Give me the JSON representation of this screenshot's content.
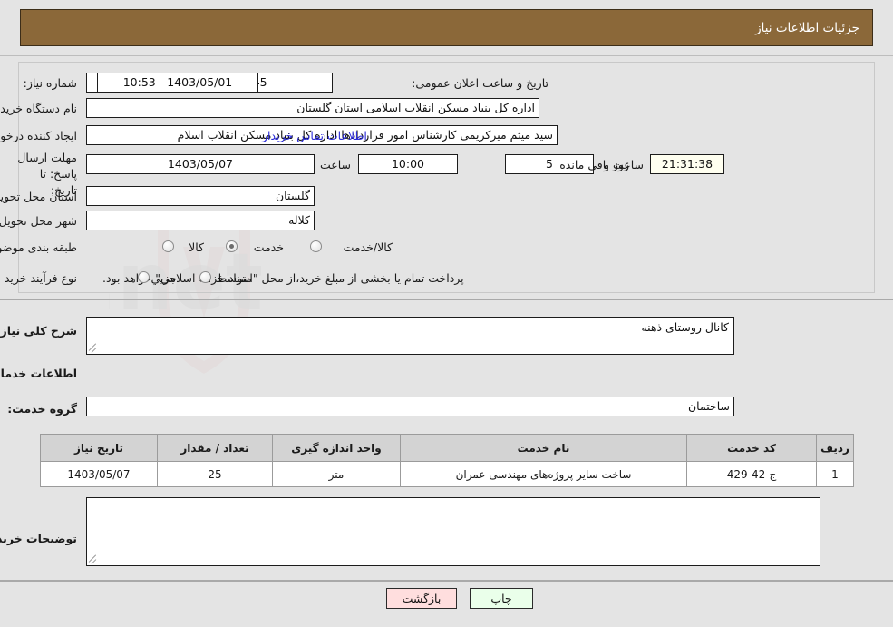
{
  "header": {
    "title": "جزئیات اطلاعات نیاز",
    "bar_color": "#8b6839"
  },
  "watermark": {
    "text": "ArtaTender.net"
  },
  "need_info": {
    "need_number_label": "شماره نیاز:",
    "need_number_value": "1103003579000045",
    "announce_datetime_label": "تاریخ و ساعت اعلان عمومی:",
    "announce_datetime_value": "1403/05/01 - 10:53",
    "buyer_org_label": "نام دستگاه خریدار:",
    "buyer_org_value": "اداره کل بنیاد مسکن انقلاب اسلامی استان گلستان",
    "creator_label": "ایجاد کننده درخواست:",
    "creator_value": "سید میثم میرکریمی کارشناس امور قراردادها اداره کل بنیاد مسکن انقلاب اسلام",
    "buyer_contact_link": "اطلاعات تماس خریدار",
    "deadline_label": "مهلت ارسال پاسخ: تا تاریخ:",
    "deadline_date": "1403/05/07",
    "hour_label": "ساعت",
    "deadline_time": "10:00",
    "days_value": "5",
    "days_label": "روز و",
    "countdown_value": "21:31:38",
    "countdown_label": "ساعت باقي مانده",
    "province_label": "استان محل تحویل:",
    "province_value": "گلستان",
    "city_label": "شهر محل تحویل:",
    "city_value": "کلاله",
    "classification_label": "طبقه بندی موضوعی:",
    "classification_options": [
      {
        "label": "کالا",
        "selected": false
      },
      {
        "label": "خدمت",
        "selected": true
      },
      {
        "label": "کالا/خدمت",
        "selected": false
      }
    ],
    "process_label": "نوع فرآیند خرید :",
    "process_options": [
      {
        "label": "جزیي",
        "selected": false
      },
      {
        "label": "متوسط",
        "selected": false
      }
    ],
    "treasury_note": "پرداخت تمام یا بخشی از مبلغ خرید،از محل \"اسناد خزانه اسلامی\" خواهد بود."
  },
  "description": {
    "label": "شرح کلی نیاز:",
    "value": "کانال روستای ذهنه"
  },
  "services": {
    "section_title": "اطلاعات خدمات مورد نیاز",
    "group_label": "گروه خدمت:",
    "group_value": "ساختمان",
    "columns": [
      "ردیف",
      "کد خدمت",
      "نام خدمت",
      "واحد اندازه گیری",
      "تعداد / مقدار",
      "تاریخ نیاز"
    ],
    "rows": [
      {
        "index": "1",
        "code": "ج-42-429",
        "name": "ساخت سایر پروژه‌های مهندسی عمران",
        "unit": "متر",
        "quantity": "25",
        "need_date": "1403/05/07"
      }
    ]
  },
  "buyer_notes": {
    "label": "توضیحات خریدار:",
    "value": ""
  },
  "footer": {
    "print_label": "چاپ",
    "back_label": "بازگشت"
  }
}
